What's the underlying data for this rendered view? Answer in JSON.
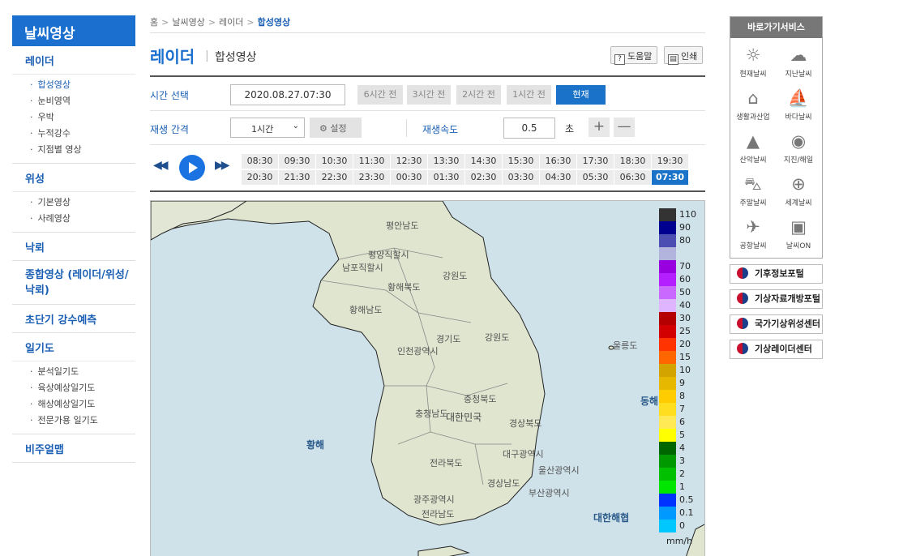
{
  "sidebar": {
    "title": "날씨영상",
    "groups": [
      {
        "label": "레이더",
        "items": [
          "합성영상",
          "눈비영역",
          "우박",
          "누적강수",
          "지점별 영상"
        ]
      },
      {
        "label": "위성",
        "items": [
          "기본영상",
          "사례영상"
        ]
      },
      {
        "label": "낙뢰"
      },
      {
        "label": "종합영상 (레이더/위성/낙뢰)"
      },
      {
        "label": "초단기 강수예측"
      },
      {
        "label": "일기도",
        "items": [
          "분석일기도",
          "육상예상일기도",
          "해상예상일기도",
          "전문가용 일기도"
        ]
      },
      {
        "label": "비주얼맵"
      }
    ]
  },
  "breadcrumb": [
    "홈",
    "날씨영상",
    "레이더",
    "합성영상"
  ],
  "page": {
    "title": "레이더",
    "subtitle": "합성영상",
    "help": "도움말",
    "print": "인쇄"
  },
  "time_select": {
    "label": "시간 선택",
    "value": "2020.08.27.07:30",
    "buttons": [
      "6시간 전",
      "3시간 전",
      "2시간 전",
      "1시간 전"
    ],
    "now": "현재"
  },
  "playback": {
    "label": "재생 간격",
    "interval": "1시간",
    "settings": "설정",
    "speed_label": "재생속도",
    "speed": "0.5",
    "unit": "초",
    "plus": "+",
    "minus": "—"
  },
  "player": {
    "slots": [
      "08:30",
      "09:30",
      "10:30",
      "11:30",
      "12:30",
      "13:30",
      "14:30",
      "15:30",
      "16:30",
      "17:30",
      "18:30",
      "19:30",
      "20:30",
      "21:30",
      "22:30",
      "23:30",
      "00:30",
      "01:30",
      "02:30",
      "03:30",
      "04:30",
      "05:30",
      "06:30",
      "07:30"
    ],
    "active": "07:30"
  },
  "map": {
    "labels": [
      "평안남도",
      "평양직할시",
      "남포직할시",
      "황해북도",
      "강원도",
      "황해남도",
      "경기도",
      "강원도",
      "인천광역시",
      "울릉도",
      "충청북도",
      "충청남도",
      "대한민국",
      "경상북도",
      "대구광역시",
      "전라북도",
      "울산광역시",
      "경상남도",
      "부산광역시",
      "광주광역시",
      "전라남도"
    ],
    "seas": [
      "황해",
      "대한해협",
      "동해"
    ],
    "legend": [
      {
        "label": "110",
        "color": "#333333"
      },
      {
        "label": "90",
        "color": "#000090"
      },
      {
        "label": "80",
        "color": "#4c4eb1"
      },
      {
        "label": "",
        "color": "#b3b4de"
      },
      {
        "label": "70",
        "color": "#9900e0"
      },
      {
        "label": "60",
        "color": "#b31fff"
      },
      {
        "label": "50",
        "color": "#c969ff"
      },
      {
        "label": "40",
        "color": "#e0b5ff"
      },
      {
        "label": "30",
        "color": "#b40000"
      },
      {
        "label": "25",
        "color": "#d20000"
      },
      {
        "label": "20",
        "color": "#ff3300"
      },
      {
        "label": "15",
        "color": "#ff6600"
      },
      {
        "label": "10",
        "color": "#d3a300"
      },
      {
        "label": "9",
        "color": "#e6b800"
      },
      {
        "label": "8",
        "color": "#ffcc00"
      },
      {
        "label": "7",
        "color": "#ffdd1f"
      },
      {
        "label": "6",
        "color": "#ffe955"
      },
      {
        "label": "5",
        "color": "#ffff00"
      },
      {
        "label": "4",
        "color": "#006600"
      },
      {
        "label": "3",
        "color": "#009900"
      },
      {
        "label": "2",
        "color": "#00c000"
      },
      {
        "label": "1",
        "color": "#00e600"
      },
      {
        "label": "0.5",
        "color": "#0033ff"
      },
      {
        "label": "0.1",
        "color": "#0099ff"
      },
      {
        "label": "0",
        "color": "#00c8ff"
      }
    ],
    "unit": "mm/h"
  },
  "quick": {
    "title": "바로가기서비스",
    "items": [
      {
        "label": "현재날씨",
        "icon": "☼"
      },
      {
        "label": "지난날씨",
        "icon": "☁"
      },
      {
        "label": "생활과산업",
        "icon": "⌂"
      },
      {
        "label": "바다날씨",
        "icon": "⛵"
      },
      {
        "label": "산악날씨",
        "icon": "▲"
      },
      {
        "label": "지진/해일",
        "icon": "◉"
      },
      {
        "label": "주말날씨",
        "icon": "⛍"
      },
      {
        "label": "세계날씨",
        "icon": "⊕"
      },
      {
        "label": "공항날씨",
        "icon": "✈"
      },
      {
        "label": "날씨ON",
        "icon": "▣"
      }
    ]
  },
  "portals": [
    "기후정보포털",
    "기상자료개방포털",
    "국가기상위성센터",
    "기상레이더센터"
  ]
}
